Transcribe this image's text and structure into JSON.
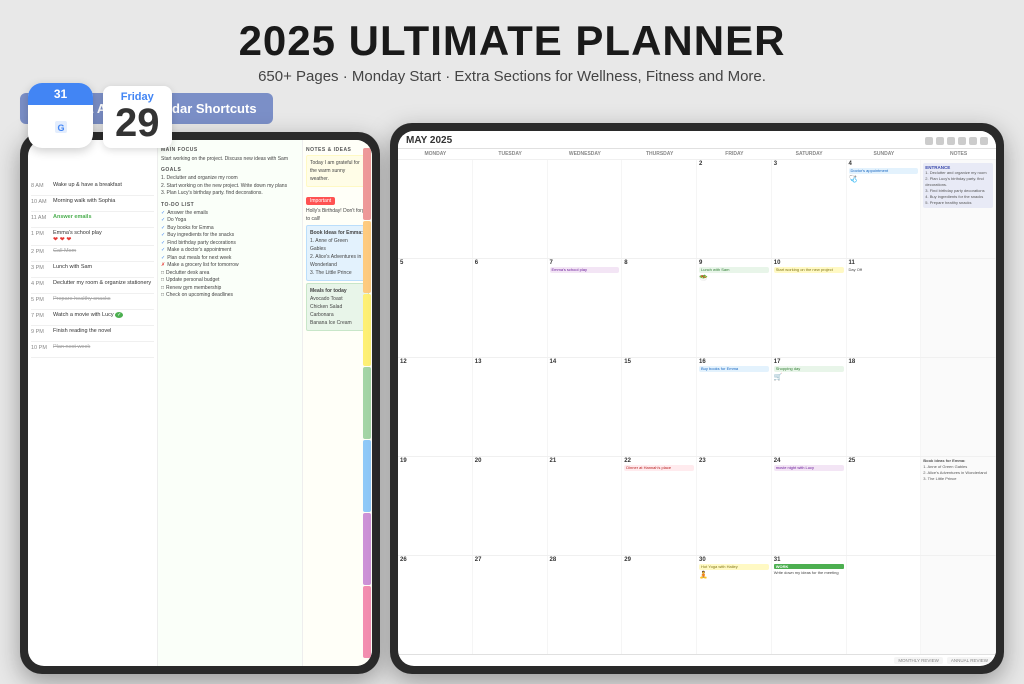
{
  "header": {
    "title": "2025 ULTIMATE PLANNER",
    "subtitle": "650+ Pages · Monday Start · Extra Sections for Wellness, Fitness and More."
  },
  "badge": {
    "label": "Google & Apple Calendar Shortcuts"
  },
  "calendar_icon": {
    "day_name": "Friday",
    "day_number": "29",
    "icon_label": "31"
  },
  "left_planner": {
    "time_slots": [
      {
        "time": "8 AM",
        "event": "Wake up & have a breakfast",
        "style": "normal"
      },
      {
        "time": "10 AM",
        "event": "Morning walk with Sophia",
        "style": "normal"
      },
      {
        "time": "11 AM",
        "event": "Answer emails",
        "style": "green"
      },
      {
        "time": "1 PM",
        "event": "Emma's school play",
        "style": "normal"
      },
      {
        "time": "",
        "event": "❤️❤️❤️",
        "style": "hearts"
      },
      {
        "time": "2 PM",
        "event": "Call Mom",
        "style": "strikethrough"
      },
      {
        "time": "3 PM",
        "event": "Lunch with Sam",
        "style": "normal"
      },
      {
        "time": "4 PM",
        "event": "Declutter my room & organize stationery",
        "style": "normal"
      },
      {
        "time": "5 PM",
        "event": "Prepare healthy snacks",
        "style": "strikethrough"
      },
      {
        "time": "7 PM",
        "event": "Watch a movie with Lucy",
        "style": "normal"
      },
      {
        "time": "9 PM",
        "event": "Finish reading the novel",
        "style": "normal"
      },
      {
        "time": "10 PM",
        "event": "Plan next week",
        "style": "strikethrough"
      }
    ],
    "main_focus": "Start working on the project. Discuss new ideas with Sam",
    "goals": [
      "1. Declutter and organize my room",
      "2. Start working on the new project. Write down my plans",
      "3. Plan Lucy's birthday party. find decorations."
    ],
    "todo": [
      "Answer the emails",
      "Do Yoga",
      "Buy books for Emma",
      "Buy ingredients for the snacks",
      "Find birthday party decorations",
      "Make a doctor's appointment",
      "Plan out meals for next week",
      "Make a grocery list for tomorrow",
      "Declutter desk area",
      "Update personal budget",
      "Renew gym membership",
      "Check on upcoming deadlines"
    ],
    "notes_title": "NOTES & IDEAS",
    "gratitude": "Today I am grateful for the warm sunny weather.",
    "important_label": "Important",
    "holly_birthday": "Holly's Birthday! Don't forget to call!",
    "book_ideas_title": "Book Ideas for Emma:",
    "book_ideas": [
      "1. Anne of Green Gables",
      "2. Alice's Adventures in Wonderland",
      "3. The Little Prince"
    ],
    "meals_title": "Meals for today",
    "meals": [
      "Avocado Toast",
      "Chicken Salad",
      "Carbonara",
      "Banana Ice Cream"
    ]
  },
  "right_calendar": {
    "month": "MAY 2025",
    "days": [
      "MONDAY",
      "TUESDAY",
      "WEDNESDAY",
      "THURSDAY",
      "FRIDAY",
      "SATURDAY",
      "SUNDAY",
      "NOTES"
    ],
    "weeks": [
      {
        "cells": [
          {
            "date": "",
            "events": []
          },
          {
            "date": "",
            "events": []
          },
          {
            "date": "",
            "events": []
          },
          {
            "date": "",
            "events": []
          },
          {
            "date": "2",
            "events": []
          },
          {
            "date": "3",
            "events": []
          },
          {
            "date": "4",
            "events": [
              "Doctor's appointment"
            ]
          },
          {
            "date": "",
            "events": [
              "ENTRANCE",
              "1. Declutter and organize my room",
              "2. Plan Lucy's birthday party. find decorations.",
              "3. Find birthday party decorations",
              "4. Buy ingredients for the snacks",
              "5. Prepare healthy snacks"
            ]
          }
        ]
      },
      {
        "cells": [
          {
            "date": "5",
            "events": []
          },
          {
            "date": "6",
            "events": []
          },
          {
            "date": "7",
            "events": [
              "Emma's school play"
            ]
          },
          {
            "date": "8",
            "events": []
          },
          {
            "date": "9",
            "events": [
              "Lunch with Sam"
            ]
          },
          {
            "date": "10",
            "events": [
              "Start working on the new project"
            ]
          },
          {
            "date": "11",
            "events": [
              "Day Off"
            ]
          },
          {
            "date": "",
            "events": []
          }
        ]
      },
      {
        "cells": [
          {
            "date": "12",
            "events": []
          },
          {
            "date": "13",
            "events": []
          },
          {
            "date": "14",
            "events": []
          },
          {
            "date": "15",
            "events": []
          },
          {
            "date": "16",
            "events": [
              "Buy books for Emma"
            ]
          },
          {
            "date": "17",
            "events": [
              "Shopping day"
            ]
          },
          {
            "date": "18",
            "events": []
          },
          {
            "date": "",
            "events": []
          }
        ]
      },
      {
        "cells": [
          {
            "date": "19",
            "events": []
          },
          {
            "date": "20",
            "events": []
          },
          {
            "date": "21",
            "events": []
          },
          {
            "date": "22",
            "events": [
              "Dinner at Hannah's place"
            ]
          },
          {
            "date": "23",
            "events": []
          },
          {
            "date": "24",
            "events": [
              "movie night with Lucy"
            ]
          },
          {
            "date": "25",
            "events": []
          },
          {
            "date": "",
            "events": [
              "Book ideas for Emma:",
              "1. Anne of Green Gables",
              "2. Alice's Adventures in Wonderland",
              "3. The Little Prince"
            ]
          }
        ]
      },
      {
        "cells": [
          {
            "date": "26",
            "events": []
          },
          {
            "date": "27",
            "events": []
          },
          {
            "date": "28",
            "events": []
          },
          {
            "date": "29",
            "events": []
          },
          {
            "date": "30",
            "events": [
              "Hot Yoga with Hailey"
            ]
          },
          {
            "date": "31",
            "events": [
              "WORK",
              "Write down my ideas for the meeting"
            ]
          },
          {
            "date": "",
            "events": []
          },
          {
            "date": "",
            "events": []
          }
        ]
      }
    ],
    "bottom_links": [
      "MONTHLY REVIEW",
      "ANNUAL REVIEW"
    ]
  }
}
